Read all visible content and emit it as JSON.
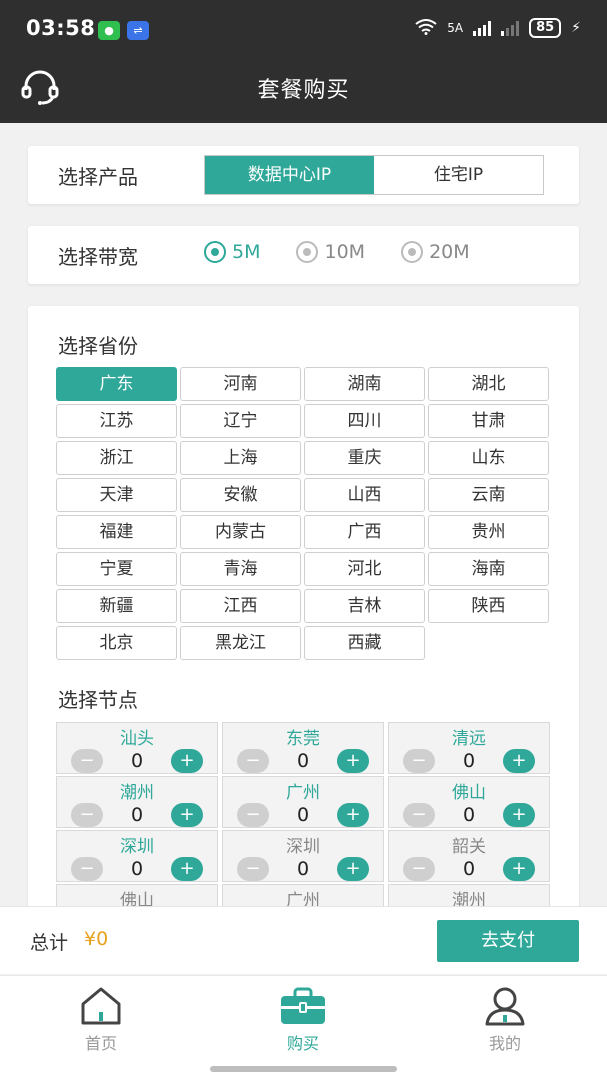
{
  "status": {
    "time": "03:58",
    "network_a": "5A",
    "battery": "85"
  },
  "header": {
    "title": "套餐购买",
    "icon": "headset-icon"
  },
  "product": {
    "label": "选择产品",
    "options": [
      "数据中心IP",
      "住宅IP"
    ],
    "selected": 0
  },
  "bandwidth": {
    "label": "选择带宽",
    "options": [
      "5M",
      "10M",
      "20M"
    ],
    "selected": 0
  },
  "province": {
    "label": "选择省份",
    "items": [
      "广东",
      "河南",
      "湖南",
      "湖北",
      "江苏",
      "辽宁",
      "四川",
      "甘肃",
      "浙江",
      "上海",
      "重庆",
      "山东",
      "天津",
      "安徽",
      "山西",
      "云南",
      "福建",
      "内蒙古",
      "广西",
      "贵州",
      "宁夏",
      "青海",
      "河北",
      "海南",
      "新疆",
      "江西",
      "吉林",
      "陕西",
      "北京",
      "黑龙江",
      "西藏"
    ],
    "selected": 0
  },
  "nodes": {
    "label": "选择节点",
    "items": [
      {
        "name": "汕头",
        "count": "0",
        "active": true
      },
      {
        "name": "东莞",
        "count": "0",
        "active": true
      },
      {
        "name": "清远",
        "count": "0",
        "active": true
      },
      {
        "name": "潮州",
        "count": "0",
        "active": true
      },
      {
        "name": "广州",
        "count": "0",
        "active": true
      },
      {
        "name": "佛山",
        "count": "0",
        "active": true
      },
      {
        "name": "深圳",
        "count": "0",
        "active": true
      },
      {
        "name": "深圳",
        "count": "0",
        "active": false
      },
      {
        "name": "韶关",
        "count": "0",
        "active": false
      },
      {
        "name": "佛山",
        "count": "",
        "active": false
      },
      {
        "name": "广州",
        "count": "",
        "active": false
      },
      {
        "name": "潮州",
        "count": "",
        "active": false
      }
    ],
    "minus": "−",
    "plus": "+"
  },
  "paybar": {
    "total_label": "总计",
    "total_value": "¥0",
    "pay_label": "去支付"
  },
  "tabs": [
    {
      "label": "首页",
      "icon": "home-icon"
    },
    {
      "label": "购买",
      "icon": "shopping-bag-icon"
    },
    {
      "label": "我的",
      "icon": "user-icon"
    }
  ],
  "colors": {
    "accent": "#2fa899",
    "price": "#e8a21c",
    "header_bg": "#2f2f2f"
  }
}
